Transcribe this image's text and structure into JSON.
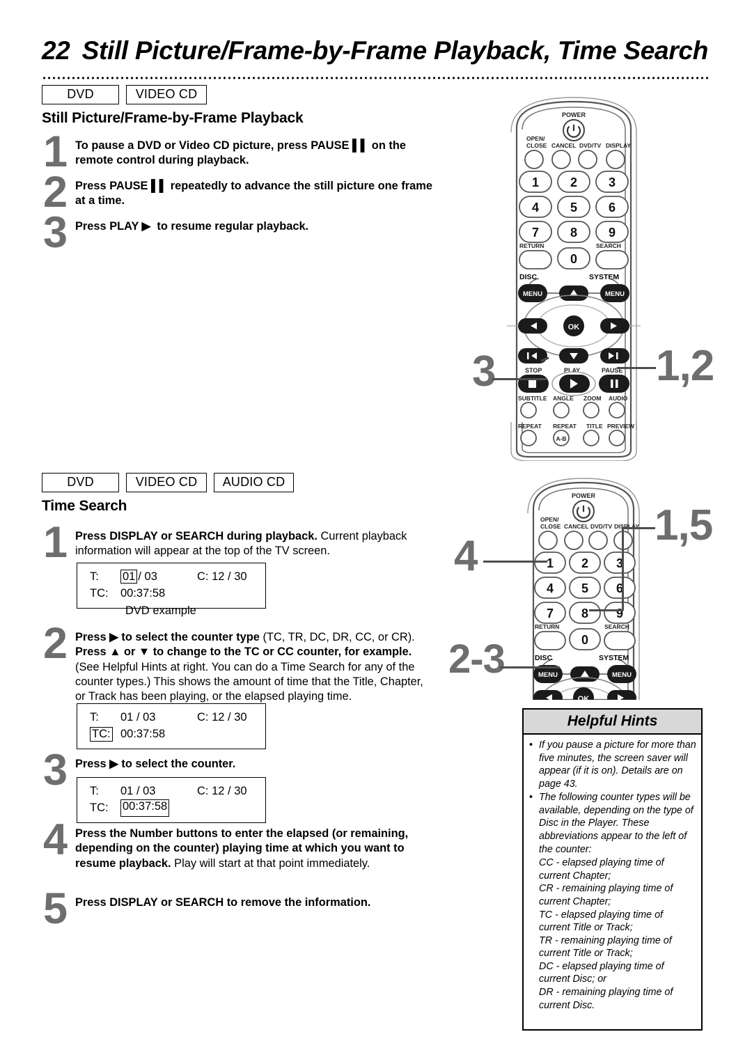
{
  "header": {
    "page_number": "22",
    "title": "Still Picture/Frame-by-Frame Playback, Time Search"
  },
  "section1": {
    "badges": [
      "DVD",
      "VIDEO CD"
    ],
    "heading": "Still Picture/Frame-by-Frame Playback",
    "steps": [
      {
        "num": "1",
        "html": "<b>To pause a DVD or Video CD picture, press PAUSE &#9612;&#9612; on the remote control during playback.</b>"
      },
      {
        "num": "2",
        "html": "<b>Press PAUSE &#9612;&#9612; repeatedly to advance the still picture one frame at a time.</b>"
      },
      {
        "num": "3",
        "html": "<b>Press PLAY &#9654; &nbsp;to resume regular playback.</b>"
      }
    ]
  },
  "section2": {
    "badges": [
      "DVD",
      "VIDEO CD",
      "AUDIO CD"
    ],
    "heading": "Time Search",
    "steps": [
      {
        "num": "1",
        "html": "<b>Press DISPLAY or SEARCH during playback.</b> <span class=\"reg\">Current playback information will appear at the top of the TV screen.</span>"
      },
      {
        "num": "2",
        "html": "<b>Press &#9654; to select the counter type</b> <span class=\"reg\">(TC, TR, DC, DR, CC, or CR).</span> <b>Press &#9650; or &#9660; to change to the TC or CC counter, for example.</b> <span class=\"reg\">(See Helpful Hints at right. You can do a Time Search for any of the counter types.) This shows the amount of time that the Title, Chapter, or Track has been playing, or the elapsed playing time.</span>"
      },
      {
        "num": "3",
        "html": "<b>Press &#9654; to select the counter.</b>"
      },
      {
        "num": "4",
        "html": "<b>Press the Number buttons to enter the elapsed (or remaining, depending on the counter) playing time at which you want to resume playback.</b> <span class=\"reg\">Play will start at that point immediately.</span>"
      },
      {
        "num": "5",
        "html": "<b>Press DISPLAY or SEARCH to remove the information.</b>"
      }
    ],
    "osd_boxes": [
      {
        "id": "osd-1",
        "title_label": "T:",
        "title_value": "01",
        "title_total": "/ 03",
        "chapter_label": "C:",
        "chapter_value": "12 / 30",
        "counter_label": "TC:",
        "counter_value": "00:37:58",
        "highlight": "title_value",
        "caption": "DVD example"
      },
      {
        "id": "osd-2",
        "title_label": "T:",
        "title_value": "01",
        "title_total": "/ 03",
        "chapter_label": "C:",
        "chapter_value": "12 / 30",
        "counter_label": "TC:",
        "counter_value": "00:37:58",
        "highlight": "counter_label",
        "caption": ""
      },
      {
        "id": "osd-3",
        "title_label": "T:",
        "title_value": "01",
        "title_total": "/ 03",
        "chapter_label": "C:",
        "chapter_value": "12 / 30",
        "counter_label": "TC:",
        "counter_value": "00:37:58",
        "highlight": "counter_value",
        "caption": ""
      }
    ]
  },
  "helpful_hints": {
    "title": "Helpful Hints",
    "bullets": [
      "If you pause a picture for more than five minutes, the screen saver will appear (if it is on). Details are on page 43.",
      "The following counter types will be available, depending on the type of Disc in the Player. These abbreviations appear to the left of the counter:"
    ],
    "counter_types": [
      "CC - elapsed playing time of current Chapter;",
      "CR - remaining playing time of current Chapter;",
      "TC - elapsed playing time of current Title or Track;",
      "TR - remaining playing time of current Title or Track;",
      "DC - elapsed playing time of current Disc; or",
      "DR - remaining playing time of current Disc."
    ]
  },
  "remote": {
    "labels": {
      "power": "POWER",
      "open_close_1": "OPEN/",
      "open_close_2": "CLOSE",
      "cancel": "CANCEL",
      "dvd_tv": "DVD/TV",
      "display": "DISPLAY",
      "return": "RETURN",
      "search": "SEARCH",
      "disc": "DISC",
      "system": "SYSTEM",
      "menu": "MENU",
      "ok": "OK",
      "stop": "STOP",
      "play": "PLAY",
      "pause": "PAUSE",
      "subtitle": "SUBTITLE",
      "angle": "ANGLE",
      "zoom": "ZOOM",
      "audio": "AUDIO",
      "repeat": "REPEAT",
      "repeat_ab": "REPEAT",
      "ab": "A-B",
      "title": "TITLE",
      "preview": "PREVIEW"
    },
    "numbers": [
      "1",
      "2",
      "3",
      "4",
      "5",
      "6",
      "7",
      "8",
      "9",
      "0"
    ]
  },
  "callouts": {
    "remote1_left": "3",
    "remote1_right": "1,2",
    "remote2_left_upper": "4",
    "remote2_left_lower": "2-3",
    "remote2_right": "1,5"
  },
  "colors": {
    "callout_gray": "#6e6e6e",
    "step_number_gray": "#6e6e6e",
    "hints_header_bg": "#d8d8d8",
    "ink": "#000000"
  }
}
